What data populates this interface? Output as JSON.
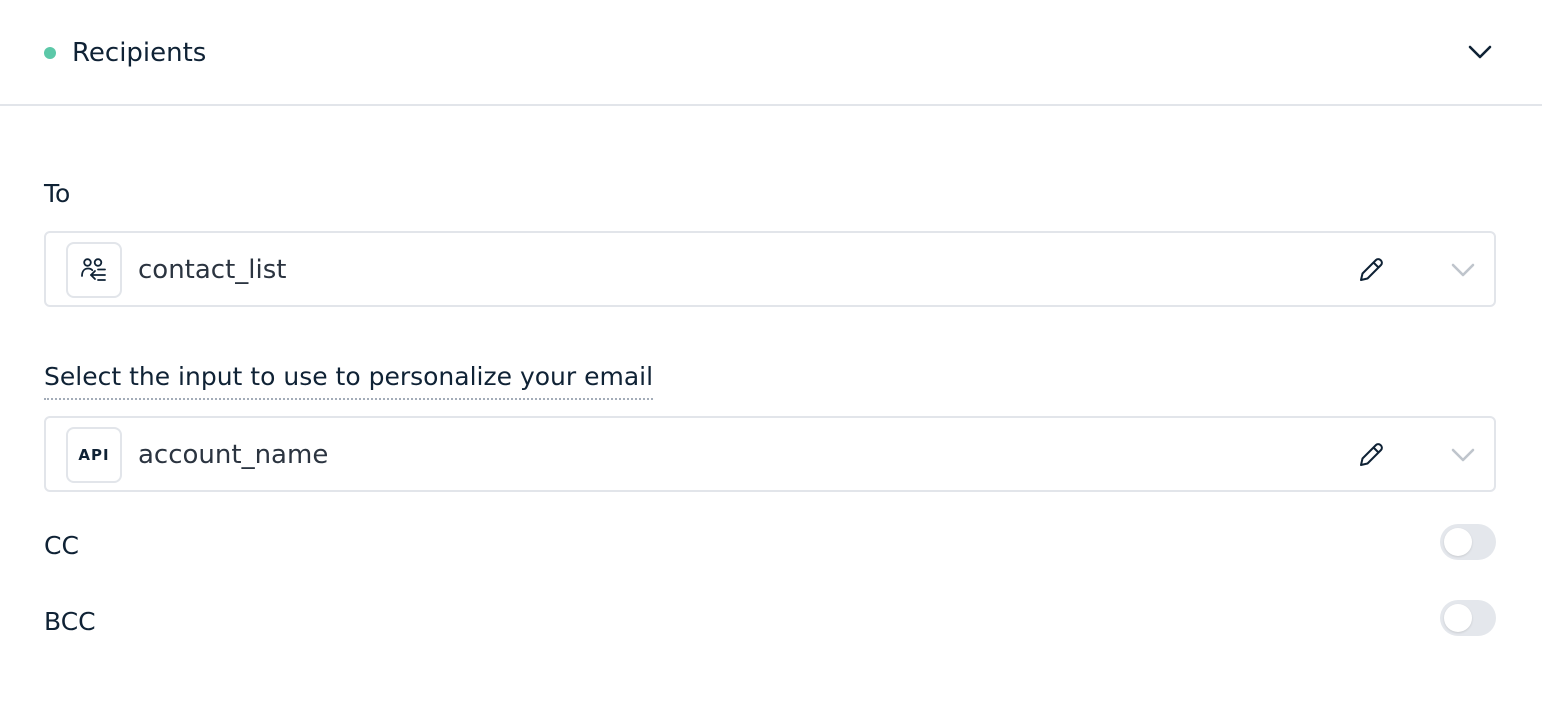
{
  "section": {
    "title": "Recipients",
    "status_color": "#5cc8a8",
    "expanded": true
  },
  "to_field": {
    "label": "To",
    "value": "contact_list",
    "type_icon": "contacts-icon"
  },
  "personalize_field": {
    "label": "Select the input to use to personalize your email",
    "value": "account_name",
    "type_badge": "API"
  },
  "cc": {
    "label": "CC",
    "enabled": false
  },
  "bcc": {
    "label": "BCC",
    "enabled": false
  },
  "icons": {
    "edit": "pencil-icon",
    "dropdown": "chevron-down-icon",
    "collapse": "chevron-down-icon"
  }
}
